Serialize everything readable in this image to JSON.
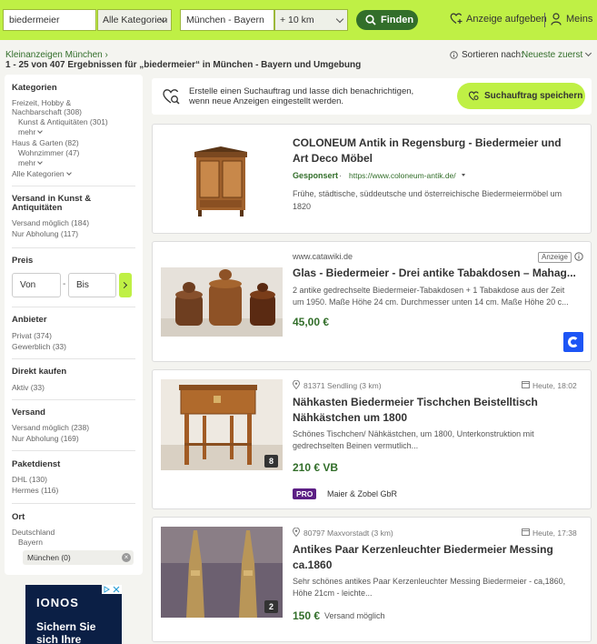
{
  "header": {
    "search_value": "biedermeier",
    "category": "Alle Kategorien",
    "location": "München - Bayern",
    "radius": "+ 10 km",
    "find_label": "Finden",
    "post_ad_label": "Anzeige aufgeben",
    "account_label": "Meins",
    "accent_color": "#bff045",
    "dark_green": "#326e2a"
  },
  "breadcrumb": "Kleinanzeigen München ›",
  "results_text": "1 - 25 von 407 Ergebnissen für „biedermeier“ in München - Bayern und Umgebung",
  "sort": {
    "label": "Sortieren nach:",
    "value": "Neueste zuerst"
  },
  "sidebar": {
    "kategorien": {
      "heading": "Kategorien",
      "freizeit": "Freizeit, Hobby &",
      "freizeit2": "Nachbarschaft (308)",
      "kunst": "Kunst & Antiquitäten (301)",
      "mehr1": "mehr",
      "haus": "Haus & Garten (82)",
      "wohnzimmer": "Wohnzimmer (47)",
      "mehr2": "mehr",
      "alle": "Alle Kategorien"
    },
    "versand_kunst": {
      "heading1": "Versand in Kunst &",
      "heading2": "Antiquitäten",
      "moeglich": "Versand möglich (184)",
      "abholung": "Nur Abholung (117)"
    },
    "preis": {
      "heading": "Preis",
      "von": "Von",
      "bis": "Bis",
      "dash": "-"
    },
    "anbieter": {
      "heading": "Anbieter",
      "privat": "Privat (374)",
      "gewerblich": "Gewerblich (33)"
    },
    "direkt": {
      "heading": "Direkt kaufen",
      "aktiv": "Aktiv (33)"
    },
    "versand": {
      "heading": "Versand",
      "moeglich": "Versand möglich (238)",
      "abholung": "Nur Abholung (169)"
    },
    "paket": {
      "heading": "Paketdienst",
      "dhl": "DHL (130)",
      "hermes": "Hermes (116)"
    },
    "ort": {
      "heading": "Ort",
      "de": "Deutschland",
      "bayern": "Bayern",
      "muenchen": "München (0)"
    }
  },
  "ad": {
    "brand": "IONOS",
    "line1": "Sichern Sie",
    "line2": "sich Ihre"
  },
  "save_search": {
    "text1": "Erstelle einen Suchauftrag und lasse dich benachrichtigen,",
    "text2": "wenn neue Anzeigen eingestellt werden.",
    "button": "Suchauftrag speichern"
  },
  "listings": [
    {
      "title1": "COLONEUM Antik in Regensburg - Biedermeier und",
      "title2": "Art Deco Möbel",
      "sponsored": "Gesponsert",
      "url": "https://www.coloneum-antik.de/",
      "desc1": "Frühe, städtische, süddeutsche und österreichische Biedermeiermöbel um",
      "desc2": "1820"
    },
    {
      "source": "www.catawiki.de",
      "badge": "Anzeige",
      "title": "Glas - Biedermeier - Drei antike Tabakdosen – Mahag...",
      "desc1": "2 antike gedrechselte Biedermeier-Tabakdosen + 1 Tabakdose aus der Zeit",
      "desc2": "um 1950. Maße Höhe 24 cm. Durchmesser unten 14 cm. Maße Höhe 20 c...",
      "price": "45,00 €"
    },
    {
      "location": "81371 Sendling (3 km)",
      "time": "Heute, 18:02",
      "title1": "Nähkasten Biedermeier Tischchen Beistelltisch",
      "title2": "Nähkästchen um 1800",
      "desc1": "Schönes Tischchen/ Nähkästchen, um 1800, Unterkonstruktion mit",
      "desc2": "gedrechselten Beinen vermutlich...",
      "price": "210 € VB",
      "image_count": "8",
      "pro": "PRO",
      "seller": "Maier & Zobel GbR"
    },
    {
      "location": "80797 Maxvorstadt (3 km)",
      "time": "Heute, 17:38",
      "title1": "Antikes Paar Kerzenleuchter Biedermeier Messing",
      "title2": "ca.1860",
      "desc1": "Sehr schönes antikes Paar Kerzenleuchter Messing Biedermeier - ca,1860,",
      "desc2": "Höhe 21cm - leichte...",
      "price": "150 €",
      "shipping": "Versand möglich",
      "image_count": "2"
    }
  ]
}
